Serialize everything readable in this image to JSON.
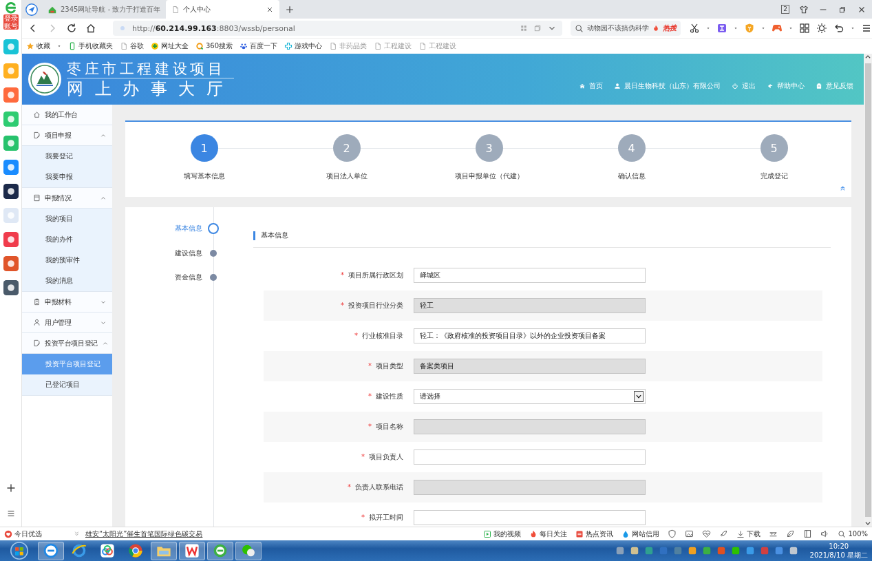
{
  "browser": {
    "tabs": [
      {
        "title": "2345网址导航 - 致力于打造百年",
        "selected": false
      },
      {
        "title": "个人中心",
        "selected": true
      }
    ],
    "tab_count": "2",
    "url": "http://**60.214.99.163**:8803/wssb/personal",
    "search": {
      "text": "动物园不该搞伪科学",
      "badge": "热搜"
    },
    "bookmarks": [
      "收藏",
      "手机收藏夹",
      "谷歌",
      "网址大全",
      "360搜索",
      "百度一下",
      "游戏中心",
      "非药品类",
      "工程建设",
      "工程建设"
    ]
  },
  "left_rail": {
    "login_badge": "登录账号"
  },
  "header": {
    "title_line1": "枣庄市工程建设项目",
    "title_line2": "网上办事大厅",
    "links": [
      "首页",
      "晨日生物科技（山东）有限公司",
      "退出",
      "帮助中心",
      "意见反馈"
    ]
  },
  "sidebar": [
    {
      "label": "我的工作台"
    },
    {
      "label": "项目申报",
      "expanded": true,
      "children": [
        {
          "label": "我要登记",
          "selected": false
        },
        {
          "label": "我要申报",
          "selected": false
        }
      ]
    },
    {
      "label": "申报情况",
      "expanded": true,
      "children": [
        {
          "label": "我的项目",
          "selected": false
        },
        {
          "label": "我的办件",
          "selected": false
        },
        {
          "label": "我的预审件",
          "selected": false
        },
        {
          "label": "我的消息",
          "selected": false
        }
      ]
    },
    {
      "label": "申报材料",
      "expanded": false
    },
    {
      "label": "用户管理",
      "expanded": false
    },
    {
      "label": "投资平台项目登记",
      "expanded": true,
      "children": [
        {
          "label": "投资平台项目登记",
          "selected": true
        },
        {
          "label": "已登记项目",
          "selected": false
        }
      ]
    }
  ],
  "steps": [
    {
      "number": "1",
      "label": "填写基本信息",
      "selected": true
    },
    {
      "number": "2",
      "label": "项目法人单位",
      "selected": false
    },
    {
      "number": "3",
      "label": "项目申报单位（代建）",
      "selected": false
    },
    {
      "number": "4",
      "label": "确认信息",
      "selected": false
    },
    {
      "number": "5",
      "label": "完成登记",
      "selected": false
    }
  ],
  "form_nav": [
    {
      "label": "基本信息",
      "selected": true
    },
    {
      "label": "建设信息",
      "selected": false
    },
    {
      "label": "资金信息",
      "selected": false
    }
  ],
  "section_title": "基本信息",
  "required_mark": "*",
  "fields": [
    {
      "label": "项目所属行政区划",
      "required": true,
      "kind": "text",
      "value": "峄城区",
      "disabled": false
    },
    {
      "label": "投资项目行业分类",
      "required": true,
      "kind": "text",
      "value": "轻工",
      "disabled": true
    },
    {
      "label": "行业核准目录",
      "required": true,
      "kind": "text",
      "value": "轻工：《政府核准的投资项目目录》以外的企业投资项目备案",
      "disabled": false
    },
    {
      "label": "项目类型",
      "required": true,
      "kind": "text",
      "value": "备案类项目",
      "disabled": true
    },
    {
      "label": "建设性质",
      "required": true,
      "kind": "select",
      "value": "请选择",
      "disabled": false
    },
    {
      "label": "项目名称",
      "required": true,
      "kind": "text",
      "disabled": true
    },
    {
      "label": "项目负责人",
      "required": true,
      "kind": "text",
      "disabled": false
    },
    {
      "label": "负责人联系电话",
      "required": true,
      "kind": "text",
      "disabled": true
    },
    {
      "label": "拟开工时间",
      "required": true,
      "kind": "text",
      "disabled": false
    }
  ],
  "status_bar": {
    "left": "今日优选",
    "news": "雄安“太阳光”催生首笔国际绿色碳交易",
    "items": [
      "我的视频",
      "每日关注",
      "热点资讯",
      "网站信用",
      "下载"
    ],
    "zoom": "100%"
  },
  "taskbar": {
    "time": "10:20",
    "date": "2021/8/10 星期二"
  }
}
